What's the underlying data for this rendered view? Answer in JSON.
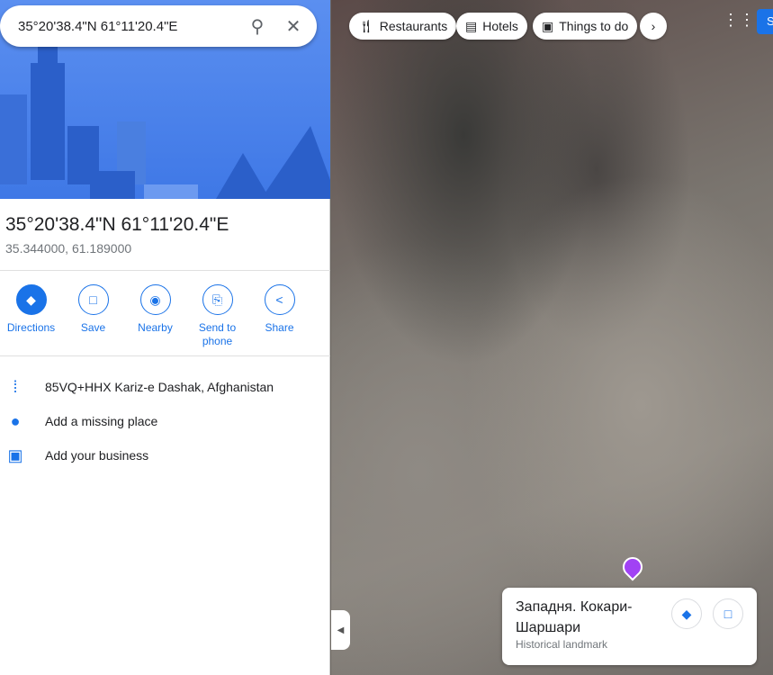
{
  "search": {
    "value": "35°20'38.4\"N 61°11'20.4\"E",
    "search_icon": "search-icon",
    "close_icon": "close-icon"
  },
  "place": {
    "title": "35°20'38.4\"N 61°11'20.4\"E",
    "coords": "35.344000, 61.189000"
  },
  "actions": [
    {
      "label": "Directions"
    },
    {
      "label": "Save"
    },
    {
      "label": "Nearby"
    },
    {
      "label": "Send to phone"
    },
    {
      "label": "Share"
    }
  ],
  "info": [
    {
      "icon": "plus-code-icon",
      "text": "85VQ+HHX Kariz-e Dashak, Afghanistan"
    },
    {
      "icon": "add-place-icon",
      "text": "Add a missing place"
    },
    {
      "icon": "add-business-icon",
      "text": "Add your business"
    }
  ],
  "chips": [
    {
      "label": "Restaurants",
      "icon": "fork-knife-icon"
    },
    {
      "label": "Hotels",
      "icon": "bed-icon"
    },
    {
      "label": "Things to do",
      "icon": "camera-icon"
    }
  ],
  "signin": {
    "label": "S"
  },
  "landmark": {
    "name": "Западня. Кокари-Шаршари",
    "type": "Historical landmark"
  },
  "colors": {
    "accent": "#1a73e8",
    "pin": "#a142f4"
  }
}
